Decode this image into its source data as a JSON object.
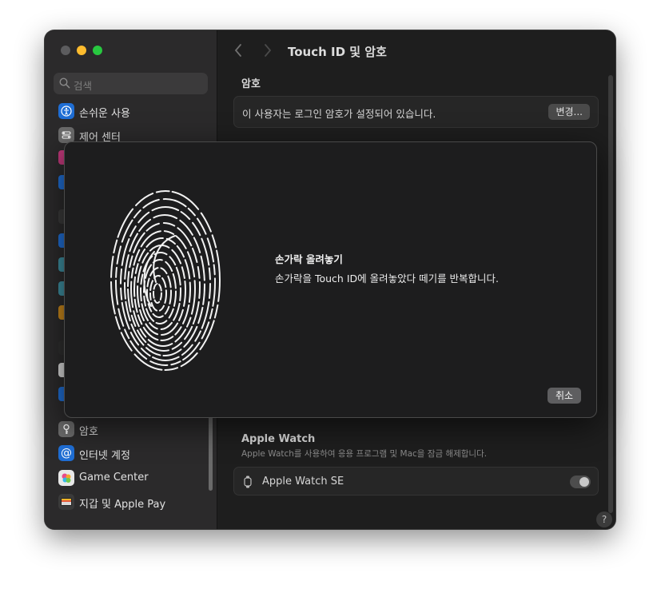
{
  "window": {
    "traffic_lights": [
      "close",
      "minimize",
      "maximize"
    ]
  },
  "sidebar": {
    "search_placeholder": "검색",
    "items_top": [
      {
        "label": "손쉬운 사용",
        "icon": "accessibility-icon",
        "color": "#1f6ed4"
      },
      {
        "label": "제어 센터",
        "icon": "control-center-icon",
        "color": "#6b6b6b"
      }
    ],
    "items_bottom": [
      {
        "label": "암호",
        "icon": "key-icon",
        "color": "#6b6b6b"
      },
      {
        "label": "인터넷 계정",
        "icon": "at-icon",
        "color": "#1f6ed4"
      },
      {
        "label": "Game Center",
        "icon": "game-center-icon",
        "color": "#e0e0e0"
      },
      {
        "label": "지갑 및 Apple Pay",
        "icon": "wallet-icon",
        "color": "#3a3a3a"
      }
    ]
  },
  "main": {
    "title": "Touch ID 및 암호",
    "password_section": {
      "heading": "암호",
      "status_text": "이 사용자는 로그인 암호가 설정되어 있습니다.",
      "change_button": "변경..."
    },
    "apple_watch_section": {
      "heading": "Apple Watch",
      "description": "Apple Watch를 사용하여 응용 프로그램 및 Mac을 잠금 해제합니다.",
      "device_name": "Apple Watch SE",
      "toggle_on": false
    },
    "help_label": "?"
  },
  "dialog": {
    "title": "손가락 올려놓기",
    "message": "손가락을 Touch ID에 올려놓았다 떼기를 반복합니다.",
    "cancel_button": "취소"
  }
}
